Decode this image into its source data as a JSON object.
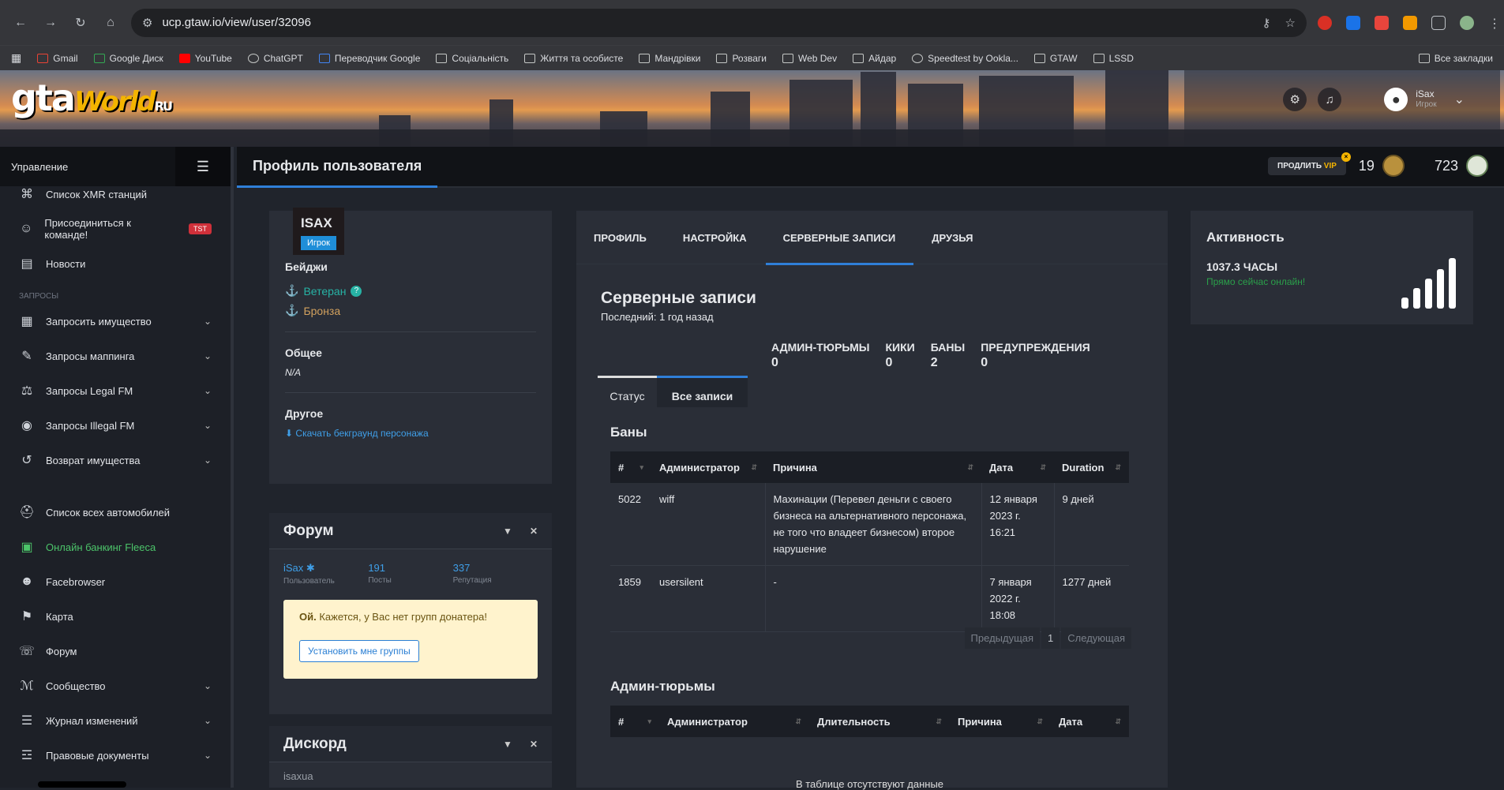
{
  "browser": {
    "url": "ucp.gtaw.io/view/user/32096",
    "bookmarks": [
      "Gmail",
      "Google Диск",
      "YouTube",
      "ChatGPT",
      "Переводчик Google",
      "Соціальність",
      "Життя та особисте",
      "Мандрівки",
      "Розваги",
      "Web Dev",
      "Айдар",
      "Speedtest by Ookla...",
      "GTAW",
      "LSSD"
    ],
    "all_bookmarks": "Все закладки"
  },
  "header": {
    "logo": "gta",
    "logo2": "World",
    "logo3": "RU",
    "username": "iSax",
    "role": "Игрок"
  },
  "sidebar": {
    "title": "Управление",
    "items": [
      {
        "label": "Список XMR станций",
        "icon": "antenna-icon"
      },
      {
        "label": "Присоединиться к команде!",
        "icon": "user-icon",
        "badge": "TST"
      }
    ],
    "items1b": [
      {
        "label": "Новости",
        "icon": "news-icon"
      }
    ],
    "section": "ЗАПРОСЫ",
    "items2": [
      {
        "label": "Запросить имущество",
        "icon": "building-icon"
      },
      {
        "label": "Запросы маппинга",
        "icon": "brush-icon"
      },
      {
        "label": "Запросы Legal FM",
        "icon": "scales-icon"
      },
      {
        "label": "Запросы Illegal FM",
        "icon": "mask-icon"
      },
      {
        "label": "Возврат имущества",
        "icon": "undo-icon"
      }
    ],
    "items3": [
      {
        "label": "Список всех автомобилей",
        "icon": "car-icon"
      },
      {
        "label": "Онлайн банкинг Fleeca",
        "icon": "money-icon"
      },
      {
        "label": "Facebrowser",
        "icon": "users-icon"
      },
      {
        "label": "Карта",
        "icon": "map-icon"
      },
      {
        "label": "Форум",
        "icon": "comments-icon"
      },
      {
        "label": "Сообщество",
        "icon": "share-icon"
      },
      {
        "label": "Журнал изменений",
        "icon": "list-icon"
      },
      {
        "label": "Правовые документы",
        "icon": "book-icon"
      }
    ]
  },
  "topbar": {
    "title": "Профиль пользователя",
    "vip_prefix": "ПРОДЛИТЬ",
    "vip": "VIP",
    "count1": "19",
    "count2": "723"
  },
  "profile": {
    "name": "ISAX",
    "role": "Игрок",
    "badges_title": "Бейджи",
    "badge1": "Ветеран",
    "badge2": "Бронза",
    "general_title": "Общее",
    "general_value": "N/A",
    "other_title": "Другое",
    "download": "Скачать бекграунд персонажа"
  },
  "forum": {
    "title": "Форум",
    "user": "iSax",
    "user_label": "Пользователь",
    "posts": "191",
    "posts_label": "Посты",
    "rep": "337",
    "rep_label": "Репутация",
    "alert_bold": "Ой.",
    "alert_text": " Кажется, у Вас нет групп донатера!",
    "alert_btn": "Установить мне группы"
  },
  "discord": {
    "title": "Дискорд",
    "value": "isaxua"
  },
  "main": {
    "tabs": [
      "ПРОФИЛЬ",
      "НАСТРОЙКА",
      "СЕРВЕРНЫЕ ЗАПИСИ",
      "ДРУЗЬЯ"
    ],
    "records_title": "Серверные записи",
    "last": "Последний: 1 год назад",
    "counts": [
      {
        "label": "АДМИН-ТЮРЬМЫ",
        "value": "0"
      },
      {
        "label": "КИКИ",
        "value": "0"
      },
      {
        "label": "БАНЫ",
        "value": "2"
      },
      {
        "label": "ПРЕДУПРЕЖДЕНИЯ",
        "value": "0"
      }
    ],
    "subtabs": [
      "Статус",
      "Все записи"
    ],
    "bans_title": "Баны",
    "bans_cols": [
      "#",
      "Администратор",
      "Причина",
      "Дата",
      "Duration"
    ],
    "bans": [
      {
        "id": "5022",
        "admin": "wiff",
        "reason": "Махинации (Перевел деньги с своего бизнеса на альтернативного персонажа, не того что владеет бизнесом) второе нарушение",
        "date": "12 января 2023 г. 16:21",
        "duration": "9 дней"
      },
      {
        "id": "1859",
        "admin": "usersilent",
        "reason": "-",
        "date": "7 января 2022 г. 18:08",
        "duration": "1277 дней"
      }
    ],
    "prev": "Предыдущая",
    "page": "1",
    "next": "Следующая",
    "jail_title": "Админ-тюрьмы",
    "jail_cols": [
      "#",
      "Администратор",
      "Длительность",
      "Причина",
      "Дата"
    ],
    "empty": "В таблице отсутствуют данные"
  },
  "activity": {
    "title": "Активность",
    "hours": "1037.3 ЧАСЫ",
    "online": "Прямо сейчас онлайн!"
  }
}
